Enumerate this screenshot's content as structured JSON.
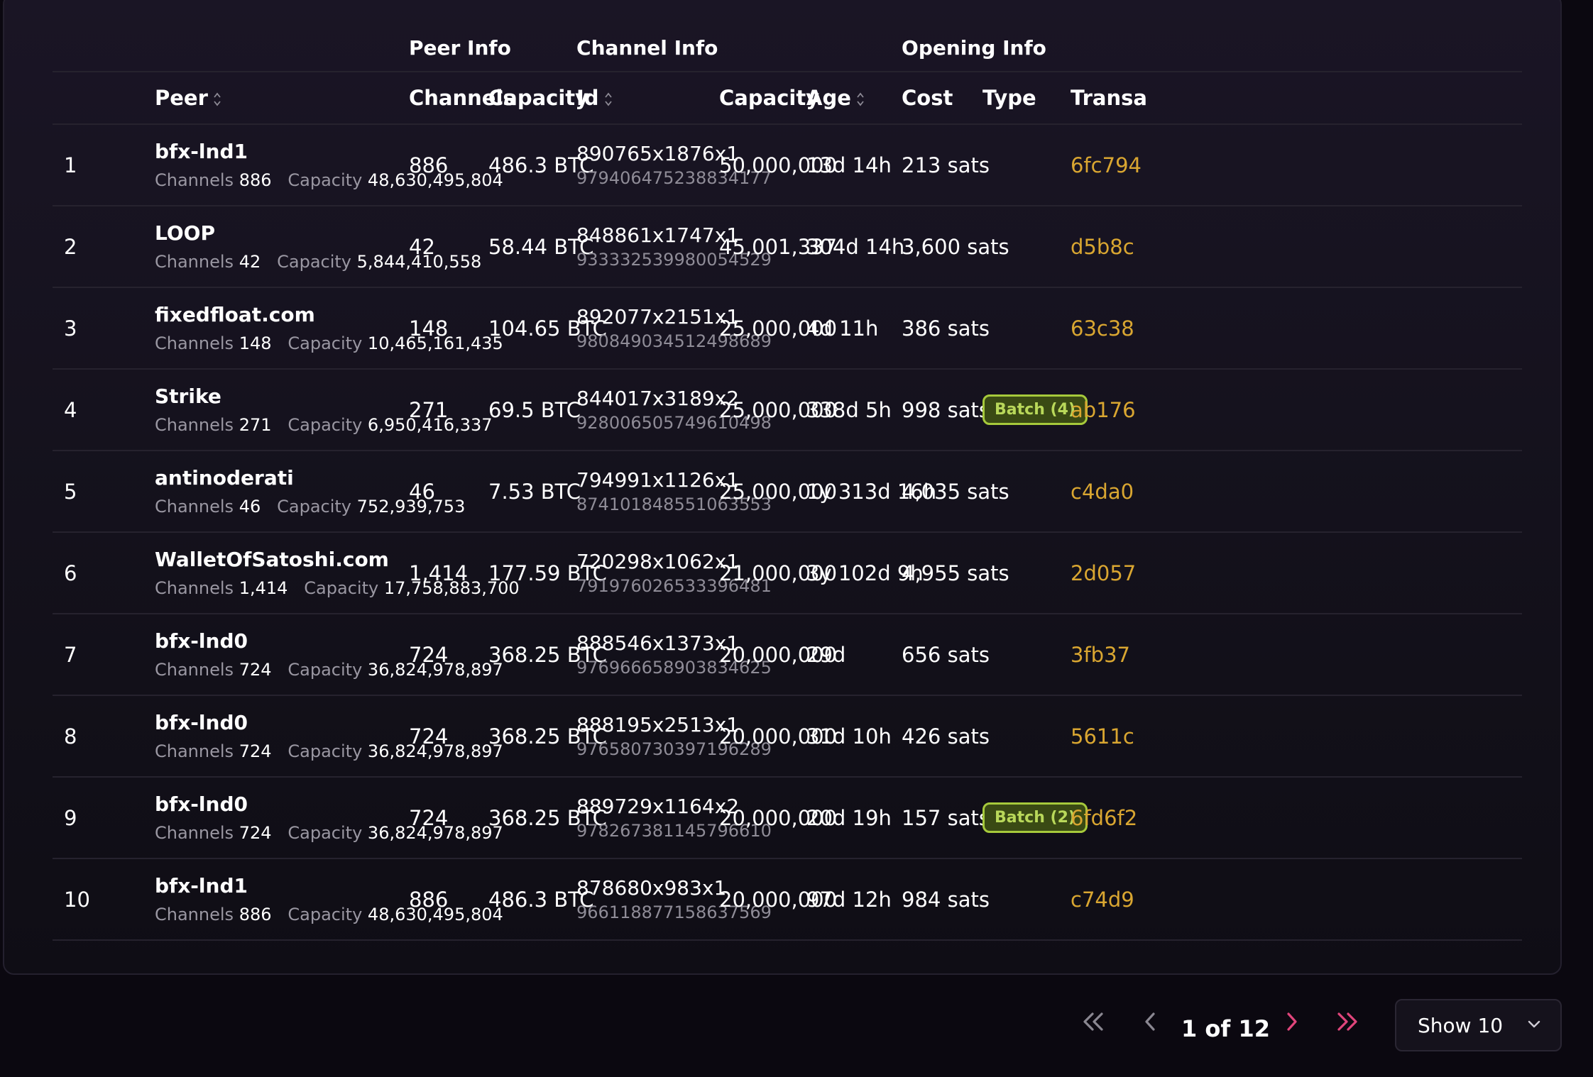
{
  "group_headers": {
    "peer_info": "Peer Info",
    "channel_info": "Channel Info",
    "opening_info": "Opening Info"
  },
  "columns": {
    "peer": "Peer",
    "channels": "Channels",
    "capacity": "Capacity",
    "id": "Id",
    "ch_capacity": "Capacity",
    "age": "Age",
    "cost": "Cost",
    "type": "Type",
    "transaction": "Transa"
  },
  "sub_labels": {
    "channels": "Channels",
    "capacity": "Capacity"
  },
  "rows": [
    {
      "n": "1",
      "peer": "bfx-lnd1",
      "channels": "886",
      "capacity_sats": "48,630,495,804",
      "ch": "886",
      "cap": "486.3 BTC",
      "id": "890765x1876x1",
      "id_long": "979406475238834177",
      "chcap": "50,000,000",
      "age": "13d 14h",
      "cost": "213 sats",
      "type": "",
      "tx": "6fc794"
    },
    {
      "n": "2",
      "peer": "LOOP",
      "channels": "42",
      "capacity_sats": "5,844,410,558",
      "ch": "42",
      "cap": "58.44 BTC",
      "id": "848861x1747x1",
      "id_long": "933332539980054529",
      "chcap": "45,001,337",
      "age": "304d 14h",
      "cost": "3,600 sats",
      "type": "",
      "tx": "d5b8c"
    },
    {
      "n": "3",
      "peer": "fixedfloat.com",
      "channels": "148",
      "capacity_sats": "10,465,161,435",
      "ch": "148",
      "cap": "104.65 BTC",
      "id": "892077x2151x1",
      "id_long": "980849034512498689",
      "chcap": "25,000,000",
      "age": "4d 11h",
      "cost": "386 sats",
      "type": "",
      "tx": "63c38"
    },
    {
      "n": "4",
      "peer": "Strike",
      "channels": "271",
      "capacity_sats": "6,950,416,337",
      "ch": "271",
      "cap": "69.5 BTC",
      "id": "844017x3189x2",
      "id_long": "928006505749610498",
      "chcap": "25,000,000",
      "age": "338d 5h",
      "cost": "998 sats",
      "type": "Batch (4)",
      "tx": "ab176"
    },
    {
      "n": "5",
      "peer": "antinoderati",
      "channels": "46",
      "capacity_sats": "752,939,753",
      "ch": "46",
      "cap": "7.53 BTC",
      "id": "794991x1126x1",
      "id_long": "874101848551063553",
      "chcap": "25,000,000",
      "age": "1y 313d 16h",
      "cost": "4,035 sats",
      "type": "",
      "tx": "c4da0"
    },
    {
      "n": "6",
      "peer": "WalletOfSatoshi.com",
      "channels": "1,414",
      "capacity_sats": "17,758,883,700",
      "ch": "1,414",
      "cap": "177.59 BTC",
      "id": "720298x1062x1",
      "id_long": "791976026533396481",
      "chcap": "21,000,000",
      "age": "3y 102d 9h",
      "cost": "4,955 sats",
      "type": "",
      "tx": "2d057"
    },
    {
      "n": "7",
      "peer": "bfx-lnd0",
      "channels": "724",
      "capacity_sats": "36,824,978,897",
      "ch": "724",
      "cap": "368.25 BTC",
      "id": "888546x1373x1",
      "id_long": "976966658903834625",
      "chcap": "20,000,000",
      "age": "29d",
      "cost": "656 sats",
      "type": "",
      "tx": "3fb37"
    },
    {
      "n": "8",
      "peer": "bfx-lnd0",
      "channels": "724",
      "capacity_sats": "36,824,978,897",
      "ch": "724",
      "cap": "368.25 BTC",
      "id": "888195x2513x1",
      "id_long": "976580730397196289",
      "chcap": "20,000,000",
      "age": "31d 10h",
      "cost": "426 sats",
      "type": "",
      "tx": "5611c"
    },
    {
      "n": "9",
      "peer": "bfx-lnd0",
      "channels": "724",
      "capacity_sats": "36,824,978,897",
      "ch": "724",
      "cap": "368.25 BTC",
      "id": "889729x1164x2",
      "id_long": "978267381145796610",
      "chcap": "20,000,000",
      "age": "20d 19h",
      "cost": "157 sats",
      "type": "Batch (2)",
      "tx": "6fd6f2"
    },
    {
      "n": "10",
      "peer": "bfx-lnd1",
      "channels": "886",
      "capacity_sats": "48,630,495,804",
      "ch": "886",
      "cap": "486.3 BTC",
      "id": "878680x983x1",
      "id_long": "966118877158637569",
      "chcap": "20,000,000",
      "age": "97d 12h",
      "cost": "984 sats",
      "type": "",
      "tx": "c74d9"
    }
  ],
  "pagination": {
    "label": "1 of 12",
    "page_size": "Show 10"
  },
  "colors": {
    "accent": "#e0457b",
    "tx": "#d9a631",
    "badge_border": "#a6c93b",
    "badge_bg": "#3a4a14"
  }
}
